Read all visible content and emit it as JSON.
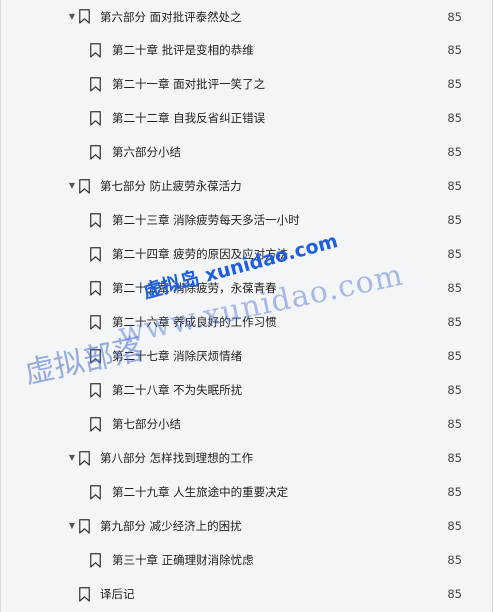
{
  "outline": {
    "items": [
      {
        "label": "第六部分 面对批评泰然处之",
        "page": "85",
        "level": 1,
        "expanded": true
      },
      {
        "label": "第二十章 批评是变相的恭维",
        "page": "85",
        "level": 2
      },
      {
        "label": "第二十一章 面对批评一笑了之",
        "page": "85",
        "level": 2
      },
      {
        "label": "第二十二章 自我反省纠正错误",
        "page": "85",
        "level": 2
      },
      {
        "label": "第六部分小结",
        "page": "85",
        "level": 2
      },
      {
        "label": "第七部分 防止疲劳永葆活力",
        "page": "85",
        "level": 1,
        "expanded": true
      },
      {
        "label": "第二十三章 消除疲劳每天多活一小时",
        "page": "85",
        "level": 2
      },
      {
        "label": "第二十四章 疲劳的原因及应对方法",
        "page": "85",
        "level": 2
      },
      {
        "label": "第二十五章 消除疲劳，永葆青春",
        "page": "85",
        "level": 2
      },
      {
        "label": "第二十六章 养成良好的工作习惯",
        "page": "85",
        "level": 2
      },
      {
        "label": "第二十七章 消除厌烦情绪",
        "page": "85",
        "level": 2
      },
      {
        "label": "第二十八章 不为失眠所扰",
        "page": "85",
        "level": 2
      },
      {
        "label": "第七部分小结",
        "page": "85",
        "level": 2
      },
      {
        "label": "第八部分 怎样找到理想的工作",
        "page": "85",
        "level": 1,
        "expanded": true
      },
      {
        "label": "第二十九章 人生旅途中的重要决定",
        "page": "85",
        "level": 2
      },
      {
        "label": "第九部分 减少经济上的困扰",
        "page": "85",
        "level": 1,
        "expanded": true
      },
      {
        "label": "第三十章 正确理财消除忧虑",
        "page": "85",
        "level": 2
      },
      {
        "label": "译后记",
        "page": "85",
        "level": 1,
        "expanded": false
      }
    ]
  },
  "watermark": {
    "cn_text": "虚拟部落",
    "url_text": "www.xunidao.com",
    "bold_text": "虚拟岛 xunidao.com"
  },
  "icons": {
    "toggle_expanded": "caret-down-icon",
    "bookmark": "bookmark-icon"
  }
}
